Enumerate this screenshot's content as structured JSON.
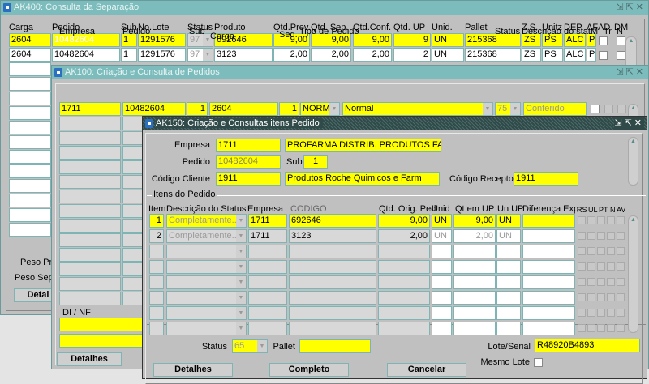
{
  "ak400": {
    "title": "AK400: Consulta da Separação",
    "headers": [
      "Carga",
      "Pedido",
      "Sub",
      "No.Lote",
      "Status",
      "Produto",
      "Qtd.Prev.",
      "Qtd. Sep.",
      "Qtd.Conf.",
      "Qtd. UP",
      "Unid.",
      "Pallet",
      "Z.S.",
      "Unitz",
      "DEP",
      "AF",
      "AD",
      "DM"
    ],
    "rows": [
      [
        "2604",
        "10482604",
        "1",
        "1291576",
        "97",
        "692646",
        "9,00",
        "9,00",
        "9,00",
        "9",
        "UN",
        "215368",
        "ZS",
        "PS",
        "ALC",
        "PF"
      ],
      [
        "2604",
        "10482604",
        "1",
        "1291576",
        "97",
        "3123",
        "2,00",
        "2,00",
        "2,00",
        "2",
        "UN",
        "215368",
        "ZS",
        "PS",
        "ALC",
        "PF"
      ]
    ],
    "peso_prev_label": "Peso Pr",
    "peso_sep_label": "Peso Sep",
    "detalhes_label": "Detal"
  },
  "ak100": {
    "title": "AK100: Criação e Consulta  de  Pedidos",
    "headers": [
      "Empresa",
      "Pedido",
      "Sub",
      "Carga",
      "Seq.",
      "Tipo de Pedido",
      "Status",
      "Descrição do stat",
      "M",
      "Tr",
      "N"
    ],
    "row": [
      "1711",
      "10482604",
      "1",
      "2604",
      "1",
      "NORM",
      "Normal",
      "75",
      "Conferido"
    ],
    "dinf_label": "DI / NF",
    "detalhes_label": "Detalhes"
  },
  "ak150": {
    "title": "AK150: Criação e Consultas itens Pedido",
    "empresa_label": "Empresa",
    "empresa": "1711",
    "empresa_nome": "PROFARMA DISTRIB. PRODUTOS FARM",
    "pedido_label": "Pedido",
    "pedido": "10482604",
    "sub_label": "Sub.",
    "sub": "1",
    "cliente_label": "Código Cliente",
    "cliente": "1911",
    "cliente_nome": "Produtos Roche Quimicos e Farm",
    "receptor_label": "Código Receptor",
    "receptor": "1911",
    "itens_label": "Itens do Pedido",
    "headers": [
      "Item",
      "Descrição do Status",
      "Empresa",
      "CODIGO",
      "Qtd. Orig. Ped",
      "Unid",
      "Qt em UP",
      "Un UP",
      "Diferença Exp.",
      "RS",
      "UL",
      "PT",
      "N",
      "AV"
    ],
    "rows": [
      [
        "1",
        "Completamente...",
        "1711",
        "692646",
        "9,00",
        "UN",
        "9,00",
        "UN",
        ""
      ],
      [
        "2",
        "Completamente...",
        "1711",
        "3123",
        "2,00",
        "UN",
        "2,00",
        "UN",
        ""
      ]
    ],
    "status_label": "Status",
    "status": "65",
    "pallet_label": "Pallet",
    "pallet": "",
    "lote_label": "Lote/Serial",
    "lote": "R48920B4893",
    "mesmo_lote_label": "Mesmo Lote",
    "buttons": {
      "detalhes": "Detalhes",
      "completo": "Completo",
      "cancelar": "Cancelar"
    }
  },
  "colors": {
    "field_highlight": "#ffff00",
    "title_active": "#2f4a48",
    "title_inactive": "#7dbcbc"
  }
}
